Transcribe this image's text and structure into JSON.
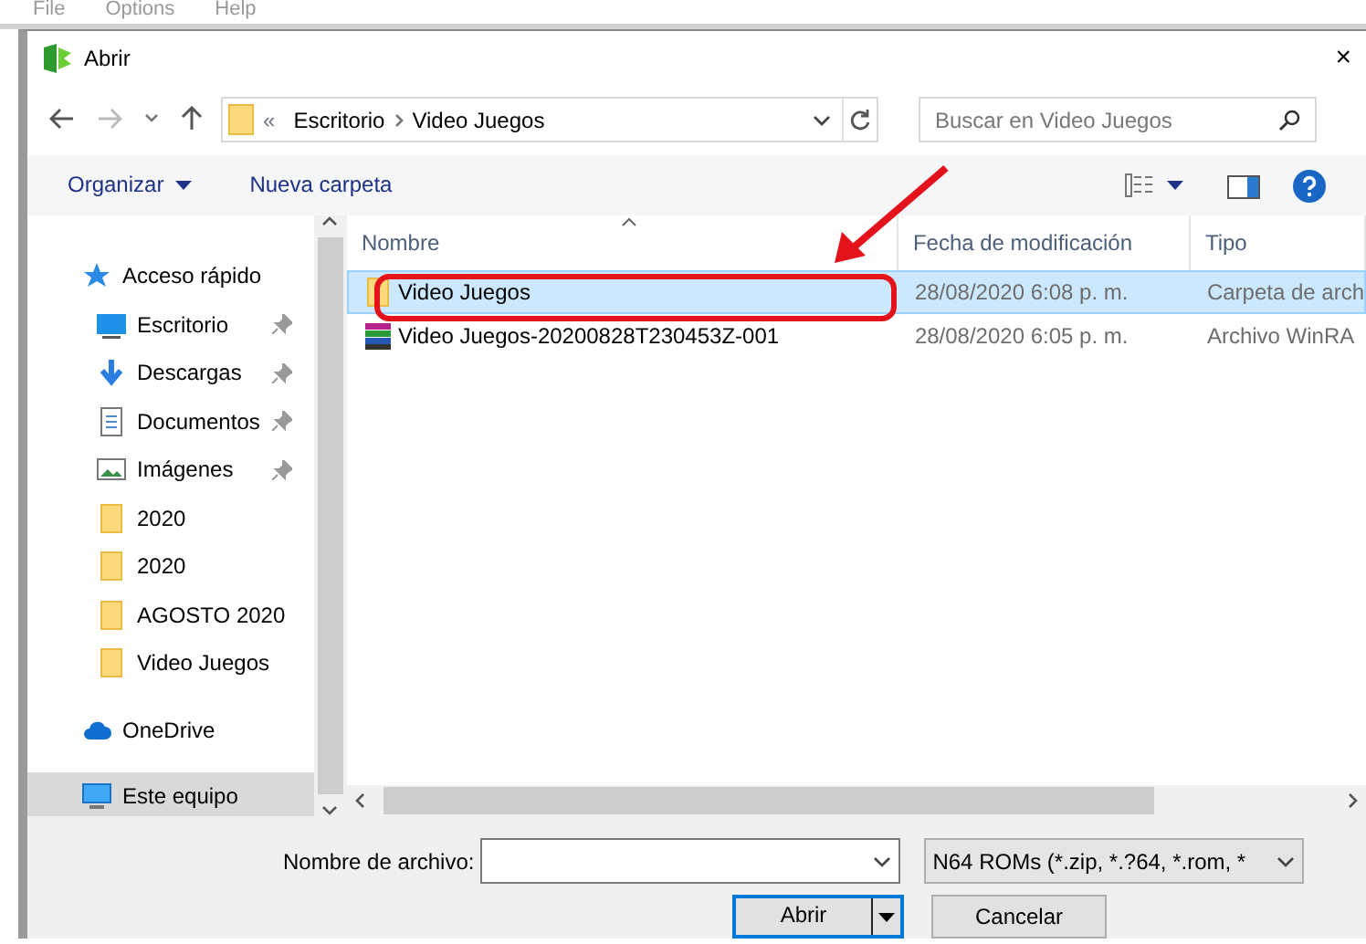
{
  "background_menu": [
    "File",
    "Options",
    "Help"
  ],
  "window": {
    "title": "Abrir",
    "close": "×"
  },
  "navigation": {
    "path": [
      "Escritorio",
      "Video Juegos"
    ],
    "path_prefix": "«",
    "search": {
      "placeholder": "Buscar en Video Juegos"
    }
  },
  "toolbar": {
    "organize": "Organizar",
    "new_folder": "Nueva carpeta"
  },
  "sidebar": {
    "items": [
      {
        "label": "Acceso rápido",
        "kind": "quick_access",
        "pinned": false,
        "selected": false
      },
      {
        "label": "Escritorio",
        "kind": "desktop",
        "pinned": true,
        "selected": false
      },
      {
        "label": "Descargas",
        "kind": "downloads",
        "pinned": true,
        "selected": false
      },
      {
        "label": "Documentos",
        "kind": "documents",
        "pinned": true,
        "selected": false
      },
      {
        "label": "Imágenes",
        "kind": "pictures",
        "pinned": true,
        "selected": false
      },
      {
        "label": "2020",
        "kind": "folder",
        "pinned": false,
        "selected": false
      },
      {
        "label": "2020",
        "kind": "folder",
        "pinned": false,
        "selected": false
      },
      {
        "label": "AGOSTO 2020",
        "kind": "folder",
        "pinned": false,
        "selected": false
      },
      {
        "label": "Video Juegos",
        "kind": "folder",
        "pinned": false,
        "selected": false
      },
      {
        "label": "OneDrive",
        "kind": "onedrive",
        "pinned": false,
        "selected": false
      },
      {
        "label": "Este equipo",
        "kind": "this_pc",
        "pinned": false,
        "selected": true
      }
    ]
  },
  "table": {
    "columns": [
      {
        "label": "Nombre",
        "sorted": true
      },
      {
        "label": "Fecha de modificación"
      },
      {
        "label": "Tipo"
      }
    ],
    "rows": [
      {
        "name": "Video Juegos",
        "date": "28/08/2020 6:08 p. m.",
        "type": "Carpeta de arch",
        "kind": "folder",
        "selected": true,
        "highlighted": true
      },
      {
        "name": "Video Juegos-20200828T230453Z-001",
        "date": "28/08/2020 6:05 p. m.",
        "type": "Archivo WinRA",
        "kind": "archive",
        "selected": false,
        "highlighted": false
      }
    ]
  },
  "footer": {
    "filename_label": "Nombre de archivo:",
    "filetype": "N64 ROMs (*.zip, *.?64, *.rom, *",
    "open": "Abrir",
    "cancel": "Cancelar"
  }
}
